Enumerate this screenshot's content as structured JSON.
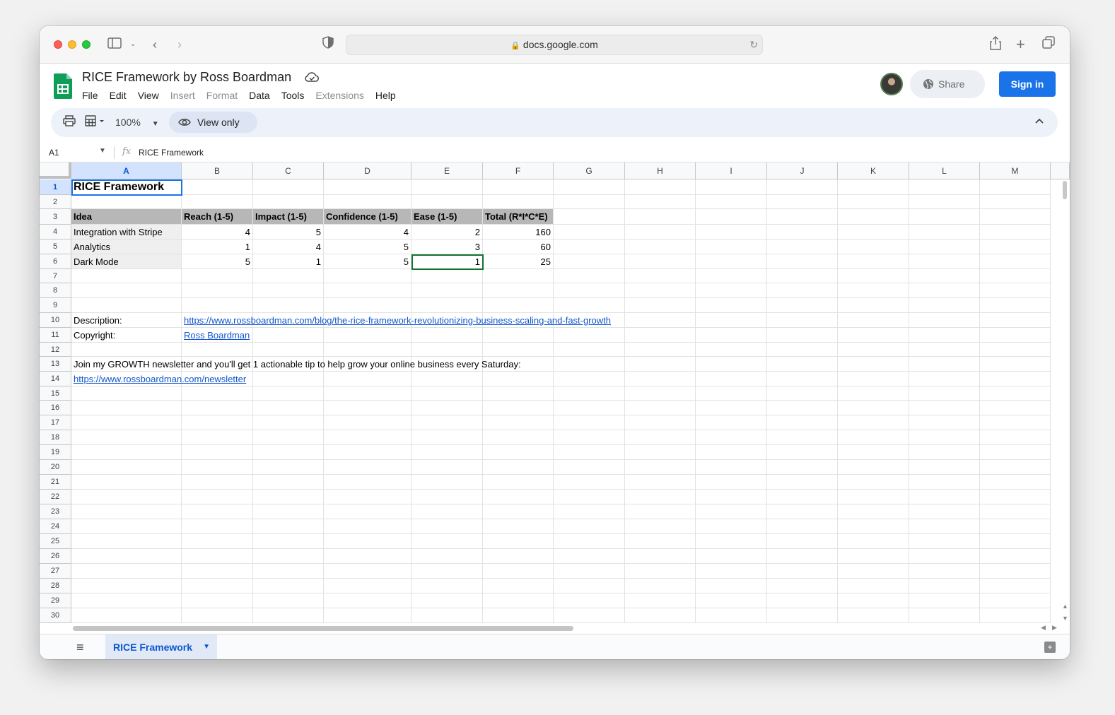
{
  "browser": {
    "url": "docs.google.com"
  },
  "app": {
    "doc_title": "RICE Framework by Ross Boardman",
    "menu": [
      {
        "label": "File",
        "enabled": true
      },
      {
        "label": "Edit",
        "enabled": true
      },
      {
        "label": "View",
        "enabled": true
      },
      {
        "label": "Insert",
        "enabled": false
      },
      {
        "label": "Format",
        "enabled": false
      },
      {
        "label": "Data",
        "enabled": true
      },
      {
        "label": "Tools",
        "enabled": true
      },
      {
        "label": "Extensions",
        "enabled": false
      },
      {
        "label": "Help",
        "enabled": true
      }
    ],
    "share_label": "Share",
    "signin_label": "Sign in",
    "accent_color": "#1a73e8"
  },
  "toolbar": {
    "zoom": "100%",
    "view_only_label": "View only"
  },
  "formula_bar": {
    "cell_ref": "A1",
    "fx": "fx",
    "value": "RICE Framework"
  },
  "columns": [
    "A",
    "B",
    "C",
    "D",
    "E",
    "F",
    "G",
    "H",
    "I",
    "J",
    "K",
    "L",
    "M"
  ],
  "rows": [
    "1",
    "2",
    "3",
    "4",
    "5",
    "6",
    "7",
    "8",
    "9",
    "10",
    "11",
    "12",
    "13",
    "14",
    "15",
    "16",
    "17",
    "18",
    "19",
    "20",
    "21",
    "22",
    "23",
    "24",
    "25",
    "26",
    "27",
    "28",
    "29",
    "30"
  ],
  "cells": {
    "A1": "RICE Framework",
    "A3": "Idea",
    "B3": "Reach (1-5)",
    "C3": "Impact (1-5)",
    "D3": "Confidence (1-5)",
    "E3": "Ease  (1-5)",
    "F3": "Total (R*I*C*E)",
    "A4": "Integration with Stripe",
    "B4": "4",
    "C4": "5",
    "D4": "4",
    "E4": "2",
    "F4": "160",
    "A5": "Analytics",
    "B5": "1",
    "C5": "4",
    "D5": "5",
    "E5": "3",
    "F5": "60",
    "A6": "Dark Mode",
    "B6": "5",
    "C6": "1",
    "D6": "5",
    "E6": "1",
    "F6": "25",
    "A10": "Description:",
    "B10": "https://www.rossboardman.com/blog/the-rice-framework-revolutionizing-business-scaling-and-fast-growth",
    "A11": "Copyright:",
    "B11": "Ross Boardman",
    "A13": "Join my GROWTH newsletter and you'll get 1 actionable tip to help grow your online business every Saturday:",
    "A14": "https://www.rossboardman.com/newsletter"
  },
  "sheet_tab": "RICE Framework"
}
